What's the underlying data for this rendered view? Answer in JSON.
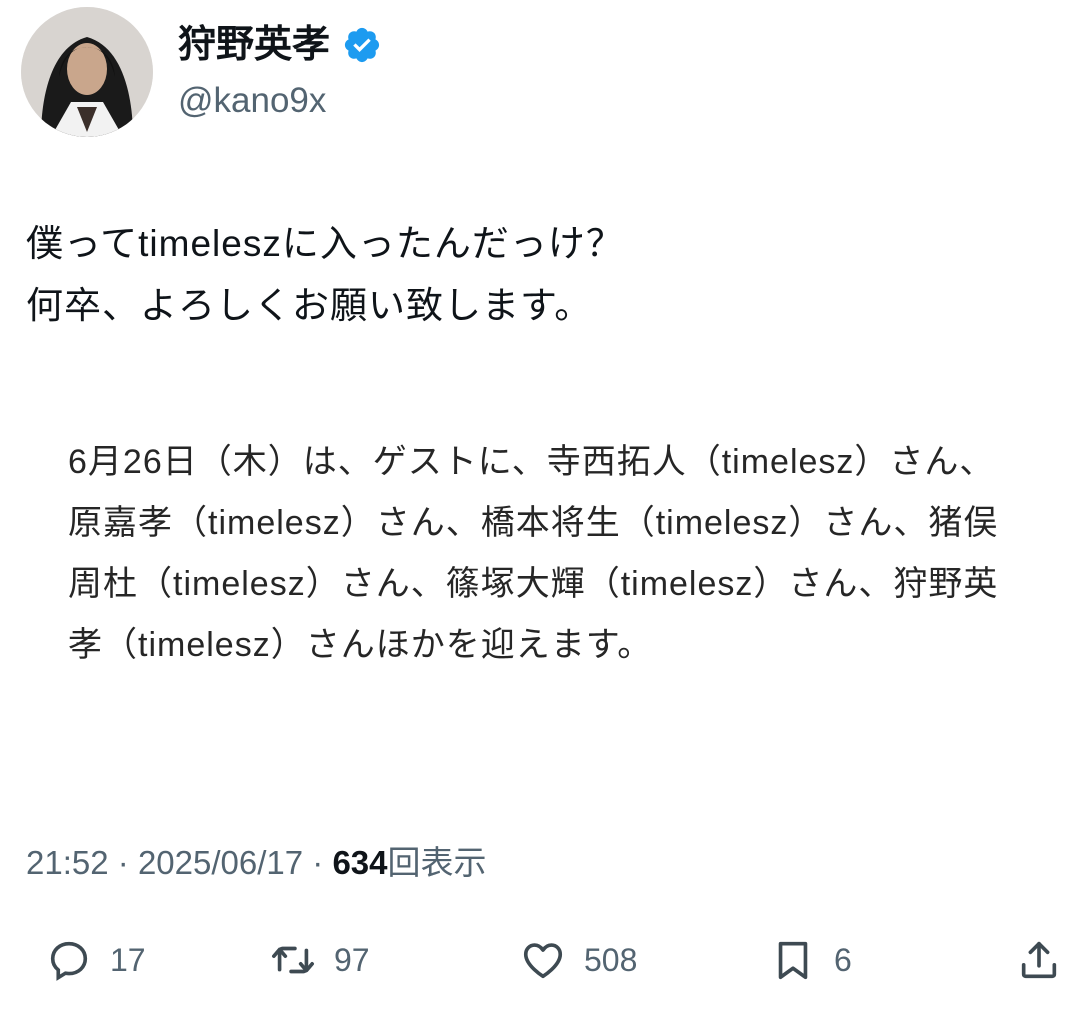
{
  "author": {
    "display_name": "狩野英孝",
    "handle": "@kano9x",
    "verified": true
  },
  "tweet": {
    "text": "僕ってtimeleszに入ったんだっけ？\n何卒、よろしくお願い致します。",
    "quoted_text": "6月26日（木）は、ゲストに、寺西拓人（timelesz）さん、原嘉孝（timelesz）さん、橋本将生（timelesz）さん、猪俣周杜（timelesz）さん、篠塚大輝（timelesz）さん、狩野英孝（timelesz）さんほかを迎えます。"
  },
  "meta": {
    "time": "21:52",
    "separator": "·",
    "date": "2025/06/17",
    "views_count": "634",
    "views_label": "回表示"
  },
  "actions": {
    "reply_count": "17",
    "retweet_count": "97",
    "like_count": "508",
    "bookmark_count": "6"
  },
  "colors": {
    "verified": "#1d9bf0",
    "secondary_text": "#536471",
    "primary_text": "#0f1419"
  },
  "icons": {
    "verified": "verified-badge-icon",
    "reply": "reply-icon",
    "retweet": "retweet-icon",
    "like": "heart-icon",
    "bookmark": "bookmark-icon",
    "share": "share-icon"
  }
}
